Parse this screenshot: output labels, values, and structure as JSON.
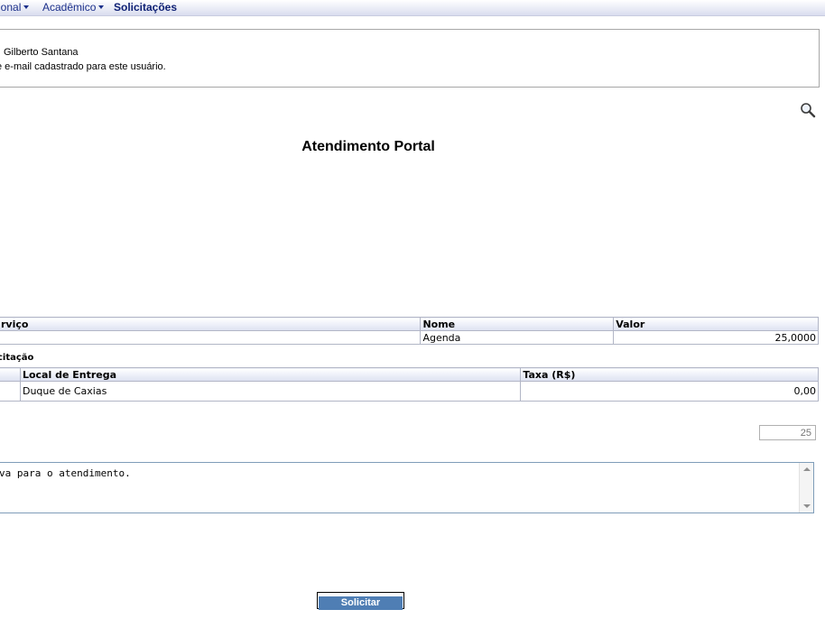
{
  "menu": {
    "items": [
      {
        "label": "ional",
        "has_arrow": true
      },
      {
        "label": "Acadêmico",
        "has_arrow": true
      },
      {
        "label": "Solicitações",
        "has_arrow": false
      }
    ]
  },
  "user_info": {
    "name_line": "Gilberto Santana",
    "email_line": "e e-mail cadastrado para este usuário."
  },
  "page": {
    "title": "Atendimento Portal",
    "search_icon": "magnifier-icon"
  },
  "service_table": {
    "headers": [
      "rviço",
      "Nome",
      "Valor"
    ],
    "rows": [
      [
        "",
        "Agenda",
        "25,0000"
      ]
    ]
  },
  "delivery_section": {
    "label": "citação",
    "headers": [
      "",
      "Local de Entrega",
      "Taxa (R$)"
    ],
    "rows": [
      [
        "",
        "Duque de Caxias",
        "0,00"
      ]
    ]
  },
  "quantity_input": {
    "placeholder": "25"
  },
  "justification": {
    "text": "va para o atendimento."
  },
  "actions": {
    "submit_label": "Solicitar"
  },
  "colors": {
    "menu_link": "#1b2f8a",
    "button_bg": "#4f7eb4"
  }
}
